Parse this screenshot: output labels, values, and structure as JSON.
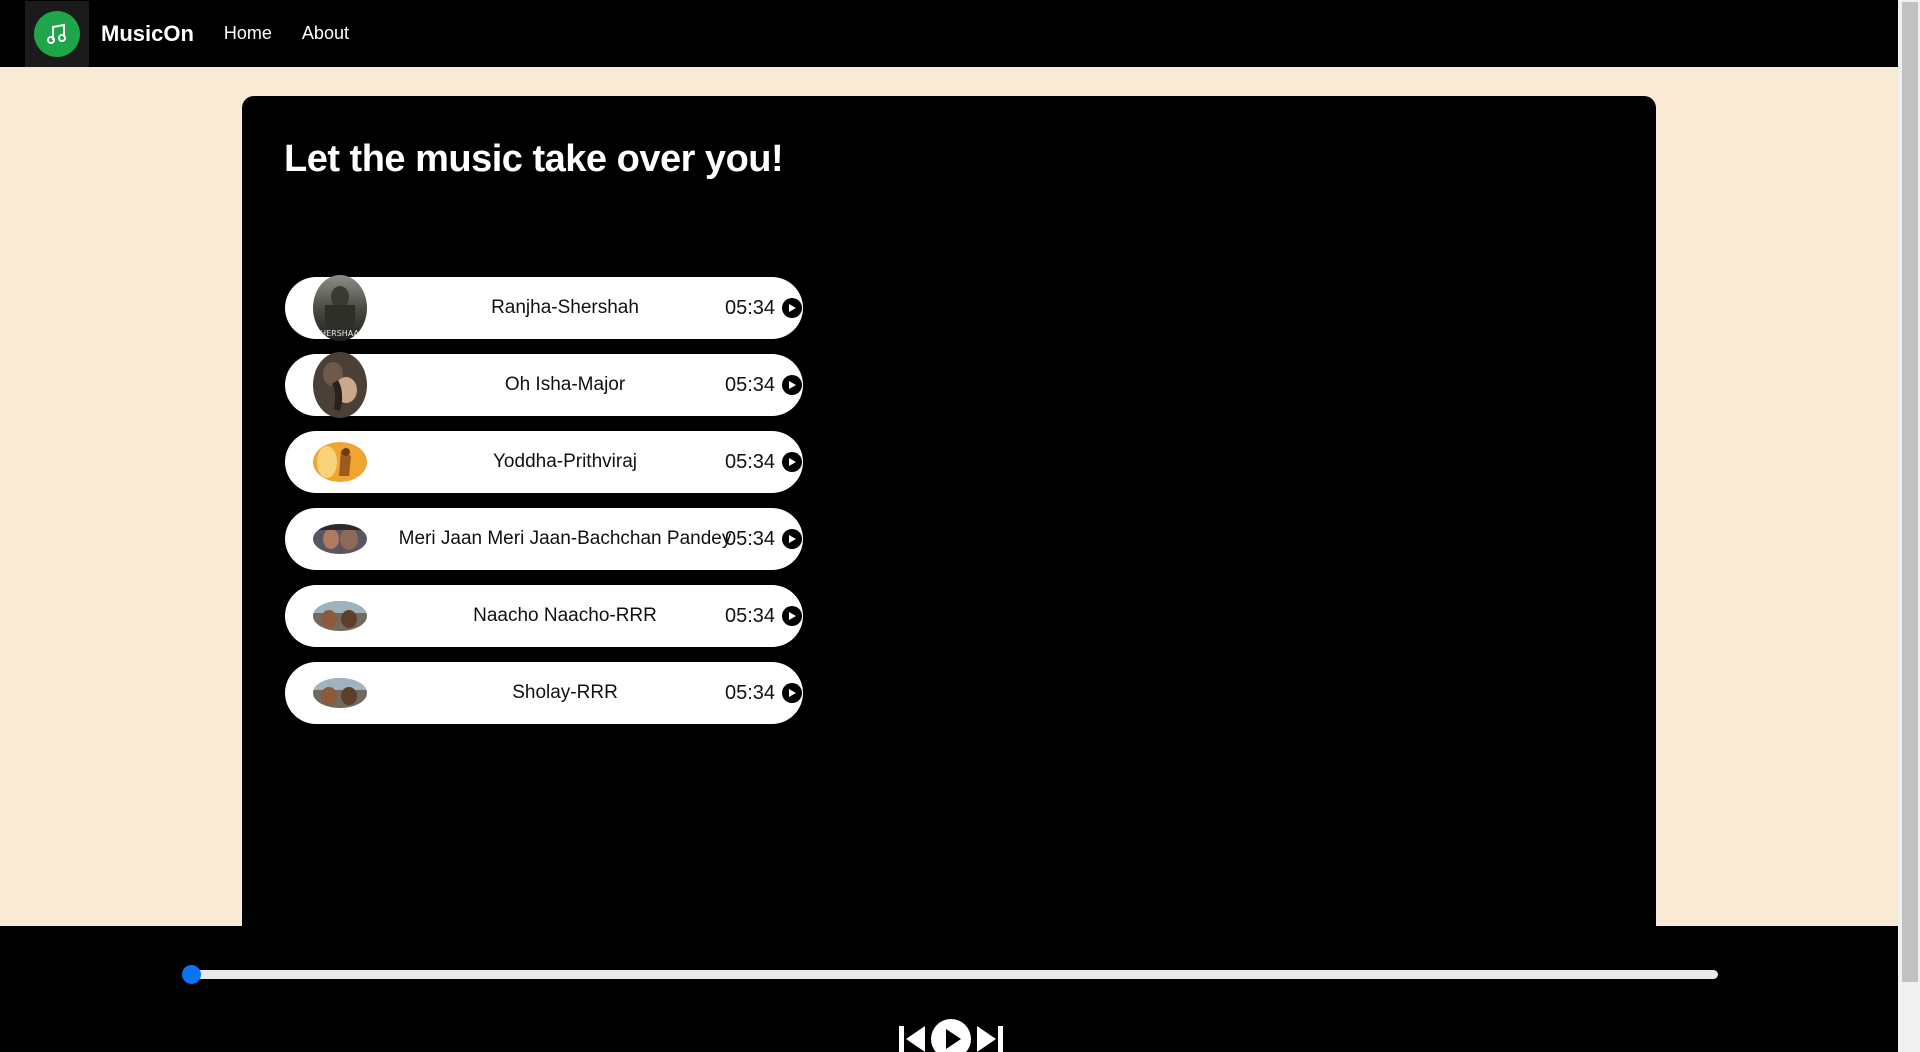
{
  "navbar": {
    "brand": "MusicOn",
    "links": [
      "Home",
      "About"
    ],
    "logo_icon": "music-note-icon",
    "logo_color": "#1fa64a"
  },
  "main": {
    "headline": "Let the music take over you!",
    "songs": [
      {
        "name": "Ranjha-Shershah",
        "duration": "05:34",
        "cover_label": "SHERSHAAH"
      },
      {
        "name": "Oh Isha-Major",
        "duration": "05:34"
      },
      {
        "name": "Yoddha-Prithviraj",
        "duration": "05:34"
      },
      {
        "name": "Meri Jaan Meri Jaan-Bachchan Pandey",
        "duration": "05:34"
      },
      {
        "name": "Naacho Naacho-RRR",
        "duration": "05:34"
      },
      {
        "name": "Sholay-RRR",
        "duration": "05:34"
      }
    ]
  },
  "player": {
    "progress": 0,
    "accent_color": "#0b74f5",
    "controls": [
      "previous-icon",
      "play-icon",
      "next-icon"
    ]
  }
}
